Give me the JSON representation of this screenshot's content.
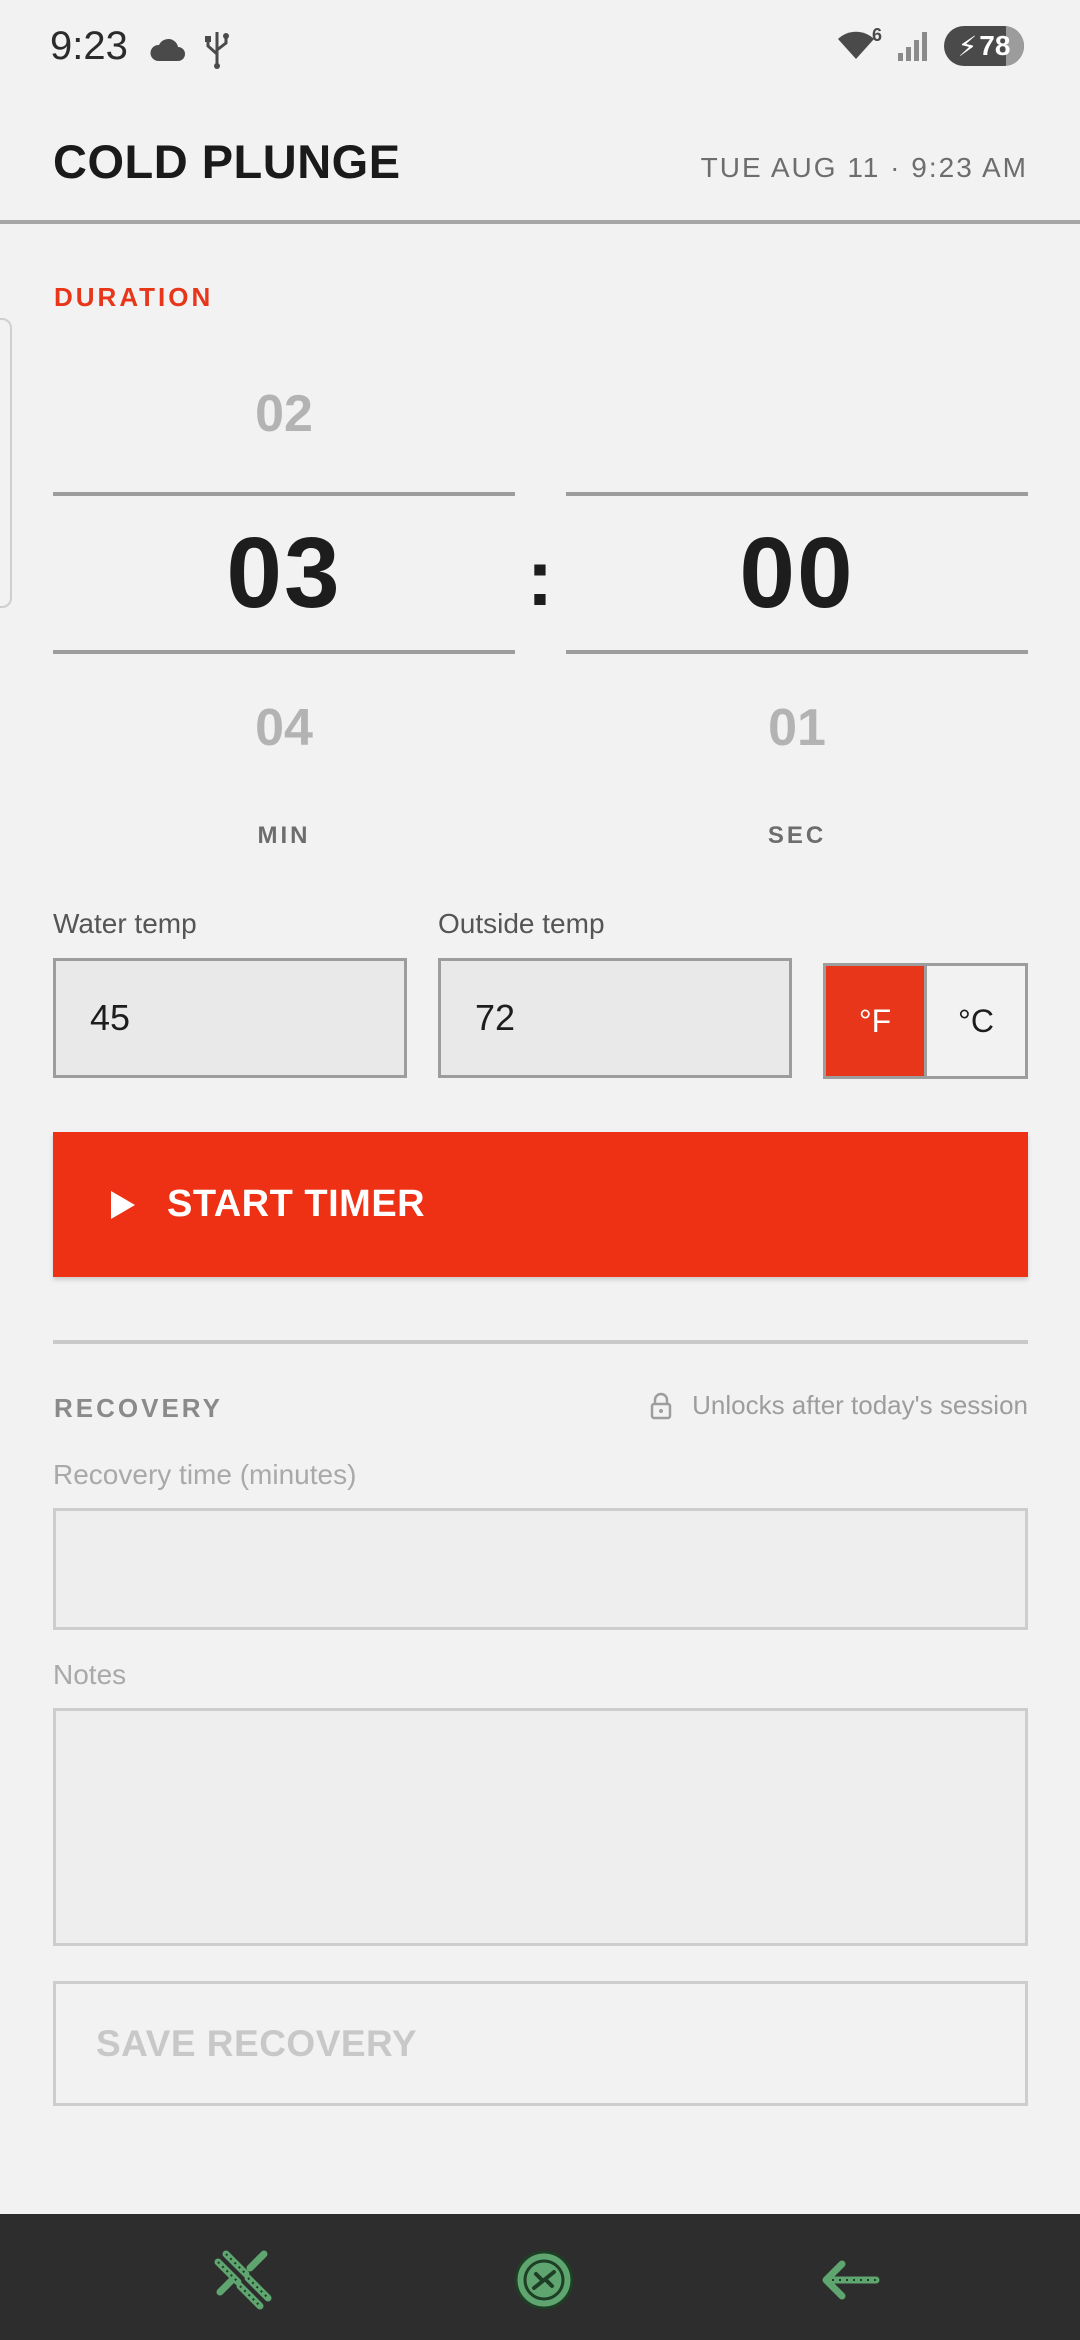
{
  "status_bar": {
    "time": "9:23",
    "wifi_badge": "6",
    "battery_level": "78",
    "icons": [
      "cloud-icon",
      "usb-icon",
      "wifi-icon",
      "signal-icon",
      "battery-charging-icon"
    ]
  },
  "header": {
    "title": "COLD PLUNGE",
    "date": "TUE AUG 11 · 9:23 AM"
  },
  "duration": {
    "label": "DURATION",
    "minutes": {
      "prev": "02",
      "current": "03",
      "next": "04",
      "unit": "MIN"
    },
    "separator": ":",
    "seconds": {
      "prev": "",
      "current": "00",
      "next": "01",
      "unit": "SEC"
    }
  },
  "temps": {
    "water_label": "Water temp",
    "water_value": "45",
    "outside_label": "Outside temp",
    "outside_value": "72",
    "unit_f": "°F",
    "unit_c": "°C",
    "selected_unit": "°F"
  },
  "start_button": {
    "label": "START TIMER"
  },
  "recovery": {
    "label": "RECOVERY",
    "lock_note": "Unlocks after today's session",
    "time_label": "Recovery time (minutes)",
    "time_value": "",
    "notes_label": "Notes",
    "notes_value": "",
    "save_label": "SAVE RECOVERY"
  },
  "bottom_nav": {
    "items": [
      "tools-icon",
      "home-circle-icon",
      "back-arrow-icon"
    ]
  },
  "colors": {
    "accent": "#ee3015",
    "background": "#f2f2f2",
    "nav_background": "#2d2d2d",
    "nav_icon": "#5fa56f"
  }
}
